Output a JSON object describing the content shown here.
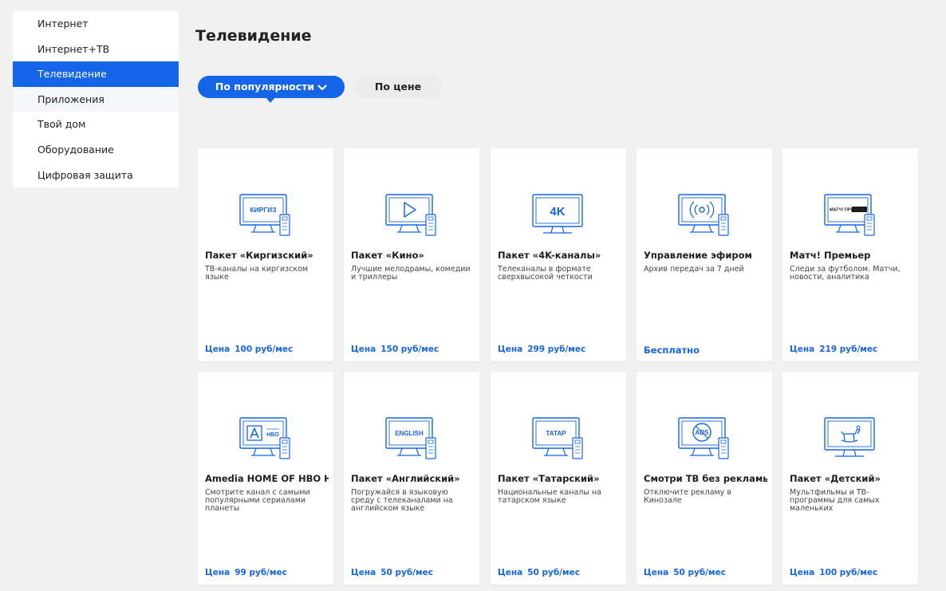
{
  "colors": {
    "accent": "#1565e8",
    "background": "#f1f1f1"
  },
  "sidebar": {
    "items": [
      {
        "label": "Интернет",
        "state": "normal"
      },
      {
        "label": "Интернет+ТВ",
        "state": "normal"
      },
      {
        "label": "Телевидение",
        "state": "active"
      },
      {
        "label": "Приложения",
        "state": "hover"
      },
      {
        "label": "Твой дом",
        "state": "normal"
      },
      {
        "label": "Оборудование",
        "state": "normal"
      },
      {
        "label": "Цифровая защита",
        "state": "normal"
      }
    ]
  },
  "page": {
    "title": "Телевидение"
  },
  "sort": {
    "active_label": "По популярности",
    "active_icon": "chevron-down-icon",
    "inactive_label": "По цене"
  },
  "cards": [
    {
      "title": "Пакет «Киргизский»",
      "desc": "ТВ-каналы на киргизском языке",
      "price_label": "Цена",
      "price": "100 руб/мес",
      "icon": "tv-kyrgyz-icon",
      "screen_text": "КИРГИЗ"
    },
    {
      "title": "Пакет «Кино»",
      "desc": "Лучшие мелодрамы, комедии и триллеры",
      "price_label": "Цена",
      "price": "150 руб/мес",
      "icon": "tv-play-icon",
      "screen_text": ""
    },
    {
      "title": "Пакет «4K-каналы»",
      "desc": "Телеканалы в формате сверхвысокой четкости",
      "price_label": "Цена",
      "price": "299 руб/мес",
      "icon": "tv-4k-icon",
      "screen_text": "4K"
    },
    {
      "title": "Управление эфиром",
      "desc": "Архив передач за 7 дней",
      "price_label": "",
      "price": "Бесплатно",
      "icon": "tv-broadcast-icon",
      "screen_text": ""
    },
    {
      "title": "Матч! Премьер",
      "desc": "Следи за футболом. Матчи, новости, аналитика",
      "price_label": "Цена",
      "price": "219 руб/мес",
      "icon": "tv-match-icon",
      "screen_text": "МАТЧ! ПРЕМЬЕР"
    },
    {
      "title": "Amedia HOME OF HBO HD",
      "desc": "Смотрите канал с самыми популярными сериалами планеты",
      "price_label": "Цена",
      "price": "99 руб/мес",
      "icon": "tv-amedia-icon",
      "screen_text": "HBO"
    },
    {
      "title": "Пакет «Английский»",
      "desc": "Погружайся в языковую среду с телеканалами на английском языке",
      "price_label": "Цена",
      "price": "50 руб/мес",
      "icon": "tv-english-icon",
      "screen_text": "ENGLISH"
    },
    {
      "title": "Пакет «Татарский»",
      "desc": "Национальные каналы на татарском языке",
      "price_label": "Цена",
      "price": "50 руб/мес",
      "icon": "tv-tatar-icon",
      "screen_text": "ТАТАР"
    },
    {
      "title": "Смотри ТВ без рекламы",
      "desc": "Отключите рекламу в Кинозале",
      "price_label": "Цена",
      "price": "50 руб/мес",
      "icon": "tv-no-ads-icon",
      "screen_text": "ADS"
    },
    {
      "title": "Пакет «Детский»",
      "desc": "Мультфильмы и ТВ-программы для самых маленьких",
      "price_label": "Цена",
      "price": "100 руб/мес",
      "icon": "tv-kids-icon",
      "screen_text": ""
    }
  ]
}
